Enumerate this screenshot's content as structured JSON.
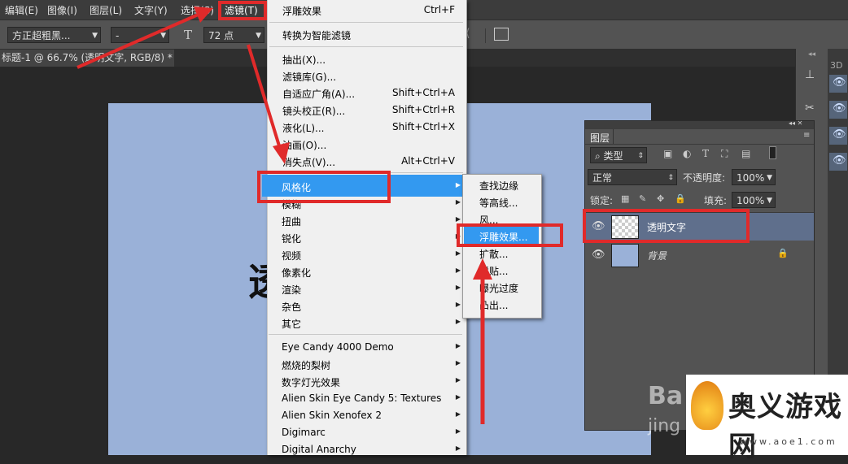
{
  "menubar": {
    "items": [
      "编辑(E)",
      "图像(I)",
      "图层(L)",
      "文字(Y)",
      "选择(S)",
      "滤镜(T)"
    ]
  },
  "options_bar": {
    "font_family": "方正超粗黑...",
    "font_style": "-",
    "font_size": "72 点"
  },
  "document_tab": {
    "title": "标题-1 @ 66.7% (透明文字, RGB/8) *"
  },
  "filter_menu": {
    "last_filter": {
      "label": "浮雕效果",
      "shortcut": "Ctrl+F"
    },
    "smart": "转换为智能滤镜",
    "items": [
      {
        "label": "抽出(X)...",
        "shortcut": ""
      },
      {
        "label": "滤镜库(G)...",
        "shortcut": ""
      },
      {
        "label": "自适应广角(A)...",
        "shortcut": "Shift+Ctrl+A"
      },
      {
        "label": "镜头校正(R)...",
        "shortcut": "Shift+Ctrl+R"
      },
      {
        "label": "液化(L)...",
        "shortcut": "Shift+Ctrl+X"
      },
      {
        "label": "油画(O)...",
        "shortcut": ""
      },
      {
        "label": "消失点(V)...",
        "shortcut": "Alt+Ctrl+V"
      }
    ],
    "submenus": [
      "风格化",
      "模糊",
      "扭曲",
      "锐化",
      "视频",
      "像素化",
      "渲染",
      "杂色",
      "其它"
    ],
    "plugins": [
      "Eye Candy 4000  Demo",
      "燃烧的梨树",
      "数字灯光效果",
      "Alien Skin Eye Candy 5: Textures",
      "Alien Skin Xenofex 2",
      "Digimarc",
      "Digital Anarchy"
    ]
  },
  "stylize_submenu": {
    "items": [
      "查找边缘",
      "等高线...",
      "风...",
      "浮雕效果...",
      "扩散...",
      "拼贴...",
      "曝光过度",
      "凸出..."
    ]
  },
  "layers_panel": {
    "title": "图层",
    "filter_kind": "类型",
    "blend_mode": "正常",
    "opacity_label": "不透明度:",
    "opacity_value": "100%",
    "lock_label": "锁定:",
    "fill_label": "填充:",
    "fill_value": "100%",
    "layers": [
      {
        "name": "透明文字",
        "selected": true
      },
      {
        "name": "背景",
        "locked": true
      }
    ]
  },
  "dock": {
    "tab_3d": "3D"
  },
  "canvas_text": "透",
  "watermark": {
    "brand": "奥义游戏网",
    "url": "www.aoe1.com",
    "baidu": "Ba",
    "jing": "jing"
  },
  "colors": {
    "highlight": "#3399f0",
    "annotation_red": "#e02a2a",
    "canvas": "#9ab1d8"
  }
}
